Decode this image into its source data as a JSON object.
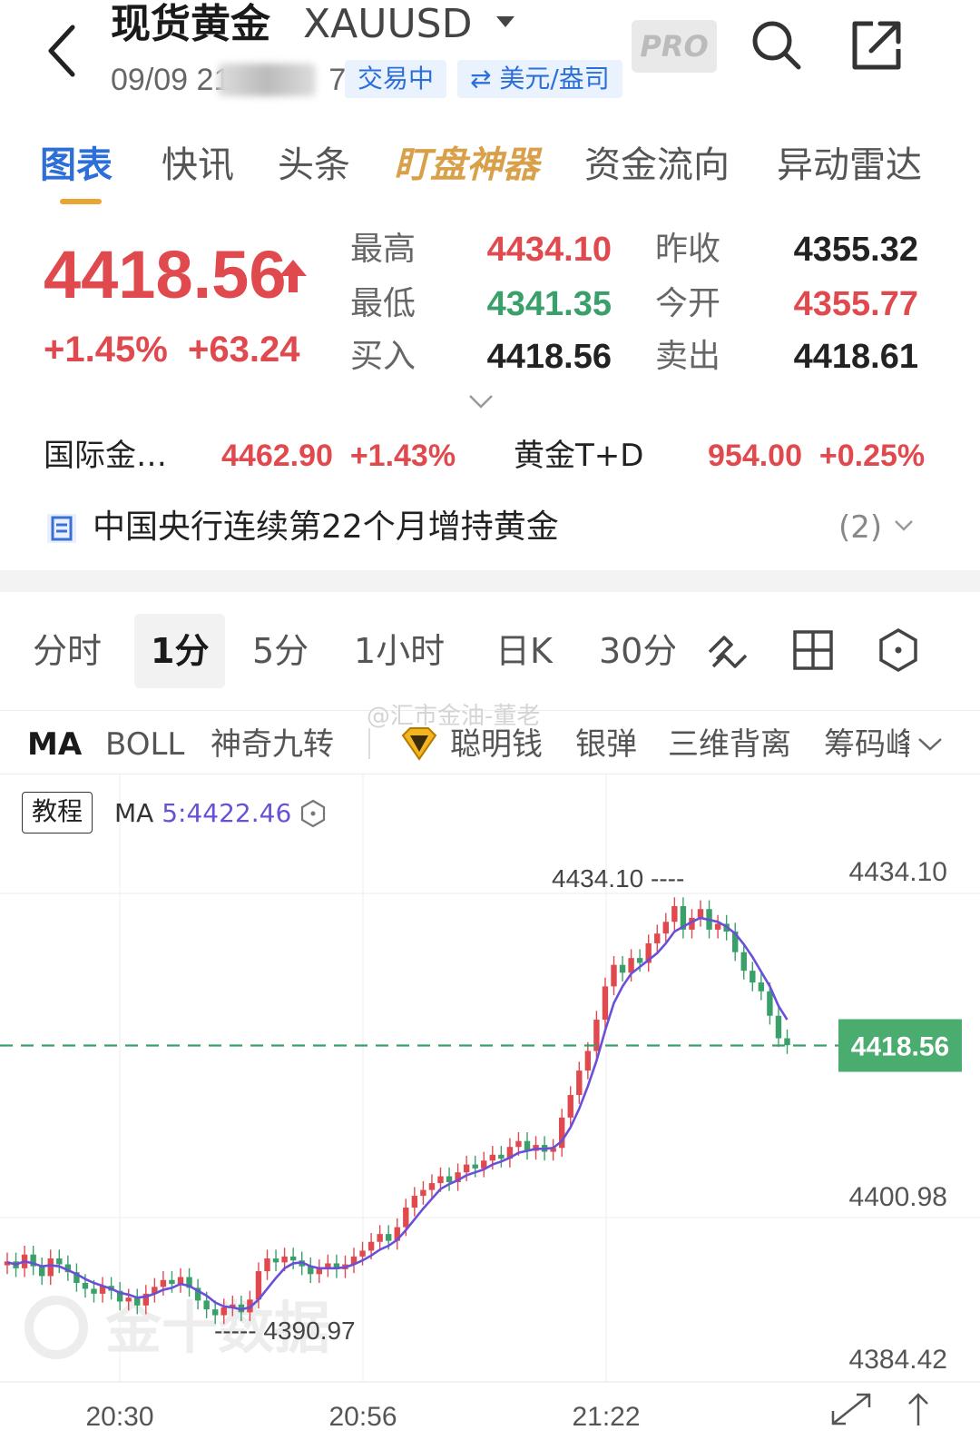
{
  "header": {
    "title": "现货黄金",
    "symbol": "XAUUSD",
    "datetime_visible": "09/09 21",
    "datetime_tail": "7",
    "status_tag": "交易中",
    "unit_tag": "⇄ 美元/盎司",
    "pro_label": "PRO"
  },
  "tabs": [
    {
      "label": "图表"
    },
    {
      "label": "快讯"
    },
    {
      "label": "头条"
    },
    {
      "label": "盯盘神器"
    },
    {
      "label": "资金流向"
    },
    {
      "label": "异动雷达"
    }
  ],
  "quote": {
    "price": "4418.56",
    "change_pct": "+1.45%",
    "change_abs": "+63.24",
    "stats": [
      {
        "label": "最高",
        "value": "4434.10",
        "color": "#e04a4e"
      },
      {
        "label": "最低",
        "value": "4341.35",
        "color": "#3aa06a"
      },
      {
        "label": "买入",
        "value": "4418.56",
        "color": "#222222"
      },
      {
        "label": "昨收",
        "value": "4355.32",
        "color": "#222222"
      },
      {
        "label": "今开",
        "value": "4355.77",
        "color": "#e04a4e"
      },
      {
        "label": "卖出",
        "value": "4418.61",
        "color": "#222222"
      }
    ]
  },
  "related": [
    {
      "name": "国际金…",
      "value": "4462.90",
      "change": "+1.43%"
    },
    {
      "name": "黄金T+D",
      "value": "954.00",
      "change": "+0.25%"
    }
  ],
  "news": {
    "headline": "中国央行连续第22个月增持黄金",
    "count": "(2)"
  },
  "timeframes": [
    "分时",
    "1分",
    "5分",
    "1小时",
    "日K",
    "30分"
  ],
  "indicators": [
    "MA",
    "BOLL",
    "神奇九转",
    "聪明钱",
    "银弹",
    "三维背离",
    "筹码峰"
  ],
  "watermark_top": "@汇市金油-董老",
  "watermark_brand": "金十数据",
  "chart_panel": {
    "tutorial_label": "教程",
    "ma_prefix": "MA",
    "ma_value": "5:4422.46"
  },
  "colors": {
    "up": "#e04a4e",
    "down": "#3aa06a",
    "accent_blue": "#2d6fd8",
    "ma_line": "#6a4fd8",
    "tab_special": "#d9a04a"
  },
  "chart_data": {
    "type": "candlestick",
    "y_ticks": [
      "4434.10",
      "4400.98",
      "4384.42"
    ],
    "x_ticks": [
      "20:30",
      "20:56",
      "21:22"
    ],
    "current_price_label": "4418.56",
    "high_annotation": "4434.10",
    "low_annotation": "4390.97",
    "ylim": [
      4384.42,
      4434.1
    ],
    "current_price": 4418.56,
    "high_point": 4434.1,
    "low_point": 4390.97,
    "candles_close": [
      4396.5,
      4395.8,
      4397.2,
      4396.0,
      4395.0,
      4396.8,
      4396.2,
      4395.4,
      4394.3,
      4393.7,
      4393.2,
      4394.0,
      4393.5,
      4392.4,
      4392.8,
      4392.0,
      4393.2,
      4393.9,
      4394.6,
      4394.2,
      4394.9,
      4393.8,
      4392.5,
      4391.6,
      4391.0,
      4391.8,
      4392.1,
      4391.3,
      4392.6,
      4395.5,
      4396.8,
      4396.4,
      4397.0,
      4396.6,
      4396.0,
      4395.2,
      4395.8,
      4396.3,
      4395.7,
      4396.2,
      4397.0,
      4397.6,
      4398.5,
      4399.3,
      4398.6,
      4400.0,
      4402.0,
      4403.2,
      4403.8,
      4404.5,
      4405.2,
      4404.6,
      4405.6,
      4406.4,
      4406.0,
      4406.8,
      4407.4,
      4407.0,
      4408.2,
      4408.8,
      4407.8,
      4408.4,
      4407.7,
      4408.1,
      4411.2,
      4413.5,
      4416.0,
      4418.0,
      4421.2,
      4424.6,
      4426.8,
      4426.0,
      4427.5,
      4427.0,
      4429.0,
      4430.0,
      4431.2,
      4432.8,
      4430.4,
      4431.6,
      4432.5,
      4430.4,
      4431.0,
      4430.2,
      4428.1,
      4426.2,
      4425.0,
      4424.1,
      4421.6,
      4419.3,
      4418.6
    ],
    "ma5": [
      4396.4,
      4396.2,
      4396.5,
      4396.3,
      4396.0,
      4396.1,
      4396.0,
      4395.6,
      4395.2,
      4394.7,
      4394.3,
      4394.0,
      4393.7,
      4393.3,
      4393.1,
      4392.8,
      4392.9,
      4393.2,
      4393.6,
      4393.8,
      4394.2,
      4394.0,
      4393.5,
      4393.0,
      4392.3,
      4391.9,
      4391.8,
      4391.6,
      4391.8,
      4392.6,
      4393.7,
      4394.8,
      4395.8,
      4396.3,
      4396.4,
      4396.0,
      4395.8,
      4395.8,
      4395.8,
      4395.9,
      4396.2,
      4396.6,
      4397.1,
      4397.7,
      4398.1,
      4398.7,
      4399.7,
      4400.8,
      4401.9,
      4402.9,
      4403.9,
      4404.4,
      4404.8,
      4405.3,
      4405.6,
      4405.9,
      4406.4,
      4406.7,
      4407.1,
      4407.6,
      4407.8,
      4408.0,
      4408.0,
      4408.1,
      4408.8,
      4410.2,
      4412.1,
      4414.4,
      4417.0,
      4420.1,
      4422.9,
      4424.6,
      4425.9,
      4426.6,
      4427.3,
      4428.0,
      4429.0,
      4430.2,
      4430.7,
      4431.2,
      4431.6,
      4431.4,
      4431.2,
      4430.7,
      4430.0,
      4428.9,
      4427.6,
      4426.1,
      4424.6,
      4422.6,
      4421.2
    ]
  }
}
